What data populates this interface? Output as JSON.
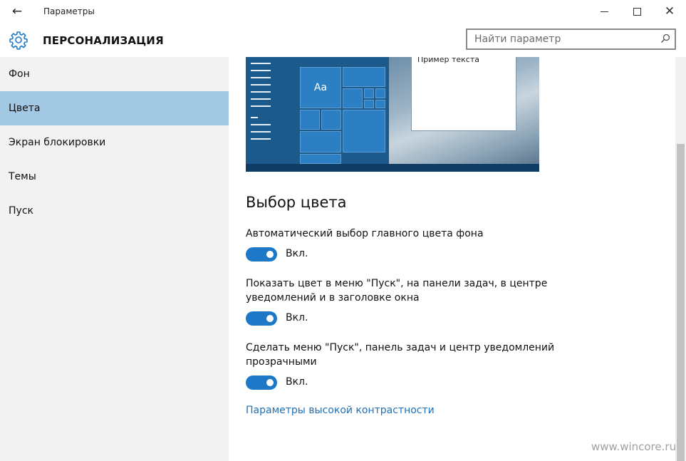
{
  "titlebar": {
    "title": "Параметры",
    "back_icon": "arrow-left-icon",
    "minimize_icon": "minimize-icon",
    "maximize_icon": "maximize-icon",
    "close_icon": "close-icon"
  },
  "header": {
    "section_title": "ПЕРСОНАЛИЗАЦИЯ",
    "search_placeholder": "Найти параметр",
    "search_value": ""
  },
  "sidebar": {
    "items": [
      {
        "label": "Фон",
        "selected": false
      },
      {
        "label": "Цвета",
        "selected": true
      },
      {
        "label": "Экран блокировки",
        "selected": false
      },
      {
        "label": "Темы",
        "selected": false
      },
      {
        "label": "Пуск",
        "selected": false
      }
    ]
  },
  "preview": {
    "tile_label": "Aa",
    "sample_text": "Пример текста"
  },
  "main": {
    "heading": "Выбор цвета",
    "settings": [
      {
        "label": "Автоматический выбор главного цвета фона",
        "toggle_on": true,
        "state_text": "Вкл."
      },
      {
        "label": "Показать цвет в меню \"Пуск\", на панели задач, в центре уведомлений и в заголовке окна",
        "toggle_on": true,
        "state_text": "Вкл."
      },
      {
        "label": "Сделать меню \"Пуск\", панель задач и центр уведомлений прозрачными",
        "toggle_on": true,
        "state_text": "Вкл."
      }
    ],
    "link": "Параметры высокой контрастности"
  },
  "watermark": "www.wincore.ru",
  "colors": {
    "accent": "#1d79c8",
    "selected_nav": "#a3c8e4",
    "sidebar_bg": "#f2f2f2",
    "link": "#1f6fb7"
  }
}
